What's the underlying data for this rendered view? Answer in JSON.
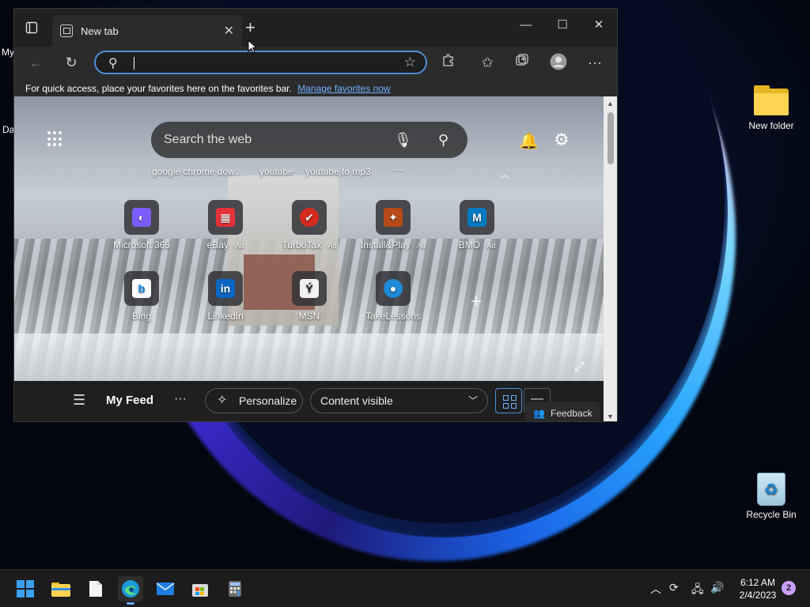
{
  "desktop": {
    "icons": [
      {
        "label": "New folder",
        "icon": "folder-icon"
      },
      {
        "label": "Recycle Bin",
        "icon": "recycle-bin-icon"
      }
    ],
    "left_slivers": [
      "My",
      "Da"
    ]
  },
  "browser": {
    "tab_title": "New tab",
    "address": {
      "value": "",
      "placeholder": ""
    },
    "favorites_bar": {
      "text": "For quick access, place your favorites here on the favorites bar.",
      "link": "Manage favorites now"
    },
    "newtab": {
      "search_placeholder": "Search the web",
      "suggestions": [
        "google chrome dow...",
        "youtube",
        "youtube to mp3"
      ],
      "tiles_row1": [
        {
          "label": "Microsoft 365",
          "ad": "",
          "color": "#7b5cff",
          "glyph": "◐"
        },
        {
          "label": "eBay",
          "ad": "· Ad",
          "color": "#e53238",
          "glyph": "▦"
        },
        {
          "label": "TurboTax",
          "ad": "· Ad",
          "color": "#d52b1e",
          "glyph": "✔"
        },
        {
          "label": "Install&Play",
          "ad": "· Ad",
          "color": "#b84a1a",
          "glyph": "✦"
        },
        {
          "label": "BMO",
          "ad": "· Ad",
          "color": "#0079c1",
          "glyph": "M"
        }
      ],
      "tiles_row2": [
        {
          "label": "Bing",
          "ad": "",
          "color": "#0c8ce9",
          "glyph": "b"
        },
        {
          "label": "LinkedIn",
          "ad": "",
          "color": "#0a66c2",
          "glyph": "in"
        },
        {
          "label": "MSN",
          "ad": "",
          "color": "#222222",
          "glyph": "Ý"
        },
        {
          "label": "TakeLessons",
          "ad": "",
          "color": "#1f8ad6",
          "glyph": "●"
        }
      ],
      "feed": {
        "title": "My Feed",
        "personalize": "Personalize",
        "content_visible": "Content visible",
        "feedback": "Feedback"
      }
    }
  },
  "taskbar": {
    "time": "6:12 AM",
    "date": "2/4/2023",
    "notifications": "2"
  }
}
